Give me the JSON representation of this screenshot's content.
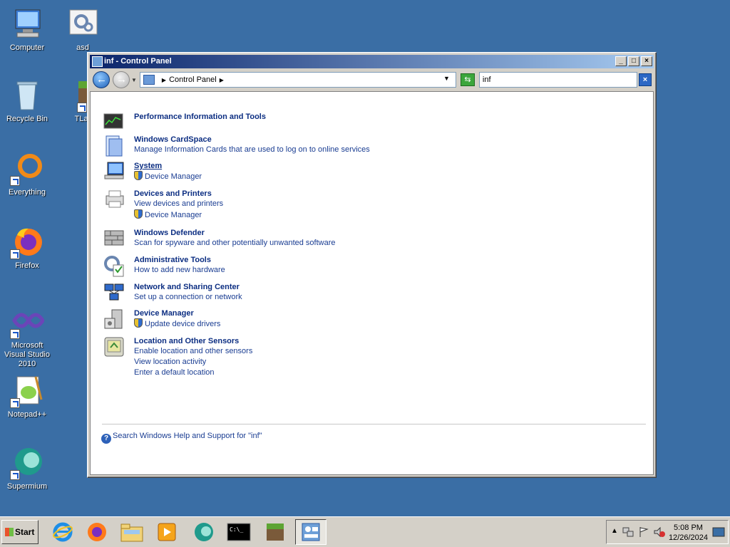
{
  "desktop": {
    "icons": [
      {
        "label": "Computer"
      },
      {
        "label": "asd"
      },
      {
        "label": "Recycle Bin"
      },
      {
        "label": "TLaunc"
      },
      {
        "label": "Everything"
      },
      {
        "label": "Firefox"
      },
      {
        "label": "Microsoft Visual Studio 2010"
      },
      {
        "label": "Notepad++"
      },
      {
        "label": "Supermium"
      }
    ]
  },
  "window": {
    "title": "inf - Control Panel",
    "address": {
      "crumb": "Control Panel"
    },
    "search": {
      "value": "inf"
    }
  },
  "results": [
    {
      "title": "Performance Information and Tools",
      "subs": []
    },
    {
      "title": "Windows CardSpace",
      "subs": [
        "Manage Information Cards that are used to log on to online services"
      ]
    },
    {
      "title": "System",
      "subs": [
        "Device Manager"
      ]
    },
    {
      "title": "Devices and Printers",
      "subs": [
        "View devices and printers",
        "Device Manager"
      ]
    },
    {
      "title": "Windows Defender",
      "subs": [
        "Scan for spyware and other potentially unwanted software"
      ]
    },
    {
      "title": "Administrative Tools",
      "subs": [
        "How to add new hardware"
      ]
    },
    {
      "title": "Network and Sharing Center",
      "subs": [
        "Set up a connection or network"
      ]
    },
    {
      "title": "Device Manager",
      "subs": [
        "Update device drivers"
      ]
    },
    {
      "title": "Location and Other Sensors",
      "subs": [
        "Enable location and other sensors",
        "View location activity",
        "Enter a default location"
      ]
    }
  ],
  "help_link": "Search Windows Help and Support for \"inf\"",
  "taskbar": {
    "start_label": "Start",
    "apps": [
      "internet-explorer",
      "firefox",
      "file-explorer",
      "media-player",
      "supermium",
      "command-prompt",
      "minecraft",
      "control-panel"
    ],
    "clock_time": "5:08 PM",
    "clock_date": "12/26/2024"
  }
}
